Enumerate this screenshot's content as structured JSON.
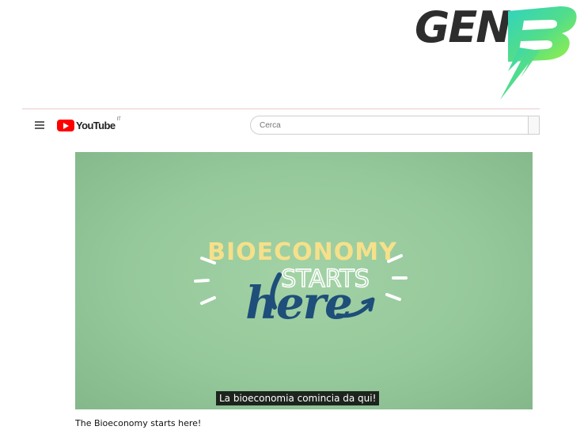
{
  "brand": {
    "text": "GEN"
  },
  "youtube": {
    "logo_text": "YouTube",
    "country": "IT",
    "search": {
      "placeholder": "Cerca"
    }
  },
  "video": {
    "art": {
      "line1": "BIOECONOMY",
      "line2": "STARTS",
      "line3": "here"
    },
    "caption": "La bioeconomia comincia da qui!",
    "title": "The Bioeconomy starts here!"
  },
  "colors": {
    "youtube_red": "#ff0000",
    "video_bg": "#95c89b",
    "art_yellow": "#f6e08a",
    "art_blue": "#1e4e79"
  }
}
